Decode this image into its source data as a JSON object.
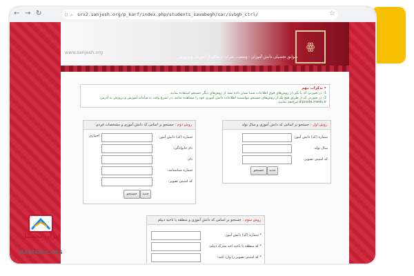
{
  "browser": {
    "url": "srv2.sanjesh.org/p_karf/index.php/students_savabegh/sar/svbgh_ctrl/",
    "back_icon": "arrow-left-icon",
    "forward_icon": "arrow-right-icon",
    "refresh_icon": "refresh-icon",
    "bookmark_icon": "star-icon"
  },
  "header": {
    "site_name": "www.sanjesh.org",
    "title": "سوابق تحصیلی دانش آموزان - وضعیت نمرات ارسالی از آموزش و پرورش"
  },
  "notice": {
    "heading": "• تذکرات مهم",
    "line1": "1- در صورتی که با یکی از روش‌های فوق اطلاعات شما نشان داده نشد از روش‌های دیگر جستجو استفاده نمایید.",
    "line2": "2- در صورتی که از طریق هیچ یک از روش‌های جستجو نتوانستید اطلاعات دانش آموزی خود را مشاهده نمایید. در اسرع وقت به سامانه آموزش و پرورش به آدرس dipcode.medu.ir مراجعه نمایید."
  },
  "method1": {
    "title_prefix": "روش اول :",
    "title_rest": "جستجو بر اساس کد دانش آموزی و سال تولد",
    "fields": [
      {
        "label": "شماره (کد) دانش آموز:",
        "value": ""
      },
      {
        "label": "سال تولد:",
        "value": ""
      },
      {
        "label": "کد امنیتی تصویر:",
        "value": ""
      }
    ],
    "search_button": "جستجو",
    "new_button": "جدید"
  },
  "method2": {
    "title_prefix": "روش دوم :",
    "title_rest": "جستجو بر اساس کد دانش آموزی و مشخصات فردی",
    "fields": [
      {
        "label": "شماره (کد) دانش آموز:",
        "value": ""
      },
      {
        "label": "نام خانوادگی:",
        "value": ""
      },
      {
        "label": "نام:",
        "value": ""
      },
      {
        "label": "شماره شناسنامه:",
        "value": ""
      },
      {
        "label": "کد امنیتی تصویر:",
        "value": ""
      }
    ],
    "side_label": "اختیاری",
    "search_button": "جستجو",
    "new_button": "جدید"
  },
  "method3": {
    "title_prefix": "روش سوم :",
    "title_rest": "جستجو بر اساس کد دانش آموزی و منطقه یا ناحیه دیپلم",
    "fields": [
      {
        "label": "* شماره (کد) دانش آموز:",
        "value": ""
      },
      {
        "label": "* کد منطقه یا ناحیه اخذ مدرک دیپلم:",
        "value": ""
      },
      {
        "label": "* کد امنیتی تصویر را وارد کنید:",
        "value": ""
      }
    ]
  },
  "watermark": {
    "persian": "ایران تحصیل",
    "english": "IRANTAHSIL.ORG"
  },
  "colors": {
    "frame_red": "#d83a48",
    "accent_yellow": "#f6c000",
    "notice_green": "#2e7d32"
  }
}
